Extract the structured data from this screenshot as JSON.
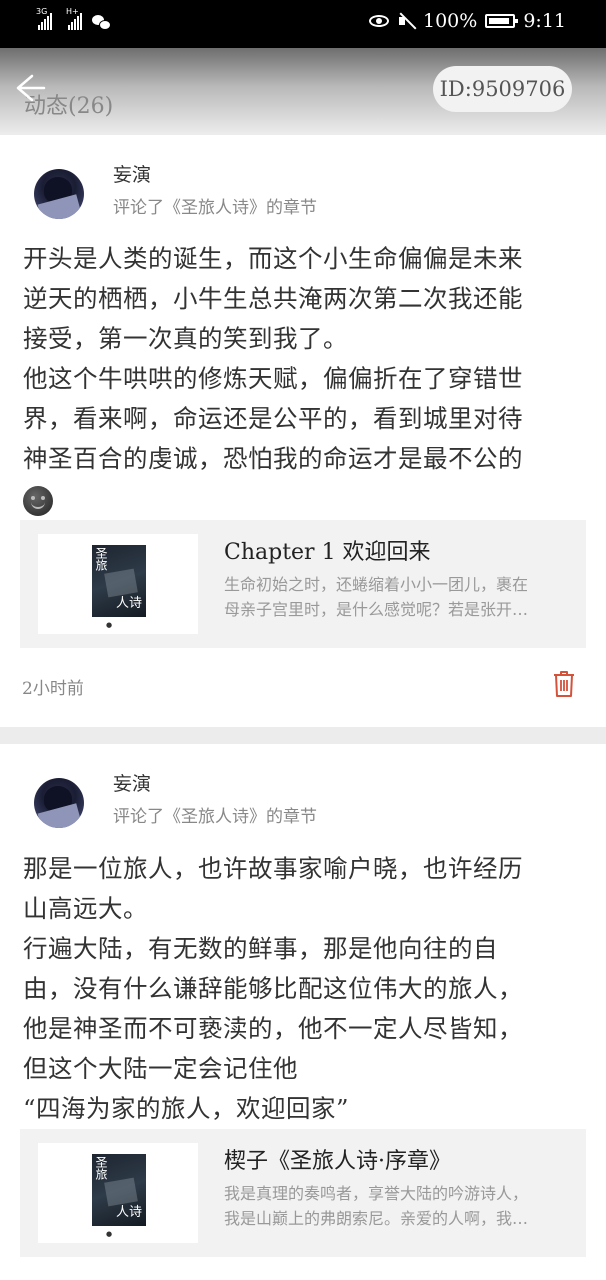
{
  "status_bar": {
    "network_1": "3G",
    "network_2": "H+",
    "battery": "100%",
    "time": "9:11"
  },
  "header": {
    "title": "动态(26)",
    "user_id": "ID:9509706"
  },
  "posts": [
    {
      "user": "妄演",
      "action": "评论了《圣旅人诗》的章节",
      "comment_lines": [
        "开头是人类的诞生，而这个小生命偏偏是未来",
        "逆天的栖栖，小牛生总共淹两次第二次我还能",
        "接受，第一次真的笑到我了。",
        "他这个牛哄哄的修炼天赋，偏偏折在了穿错世",
        "界，看来啊，命运还是公平的，看到城里对待",
        "神圣百合的虔诚，恐怕我的命运才是最不公的"
      ],
      "emoji": "smiley-dark-icon",
      "chapter": {
        "cover_title": "圣旅",
        "cover_sub": "人诗",
        "title": "Chapter 1 欢迎回来",
        "excerpt_lines": [
          "生命初始之时，还蜷缩着小小一团儿，裹在",
          "母亲子宫里时，是什么感觉呢？若是张开…"
        ]
      },
      "time": "2小时前"
    },
    {
      "user": "妄演",
      "action": "评论了《圣旅人诗》的章节",
      "comment_lines": [
        "那是一位旅人，也许故事家喻户晓，也许经历",
        "山高远大。",
        "行遍大陆，有无数的鲜事，那是他向往的自",
        "由，没有什么谦辞能够比配这位伟大的旅人，",
        "他是神圣而不可亵渎的，他不一定人尽皆知，",
        "但这个大陆一定会记住他",
        " “四海为家的旅人，欢迎回家”"
      ],
      "chapter": {
        "cover_title": "圣旅",
        "cover_sub": "人诗",
        "title": "楔子《圣旅人诗·序章》",
        "excerpt_lines": [
          "我是真理的奏鸣者，享誉大陆的吟游诗人，",
          "我是山巅上的弗朗索尼。亲爱的人啊，我…"
        ]
      }
    }
  ]
}
